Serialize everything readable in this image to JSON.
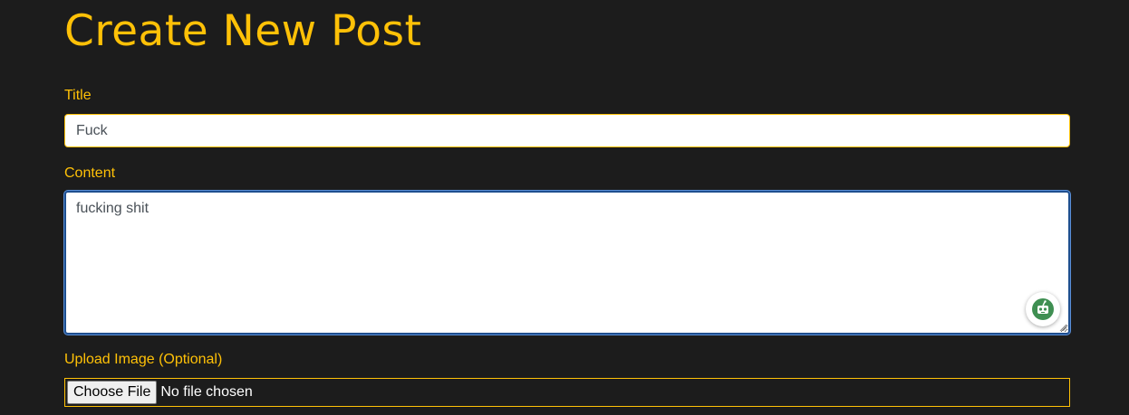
{
  "page": {
    "heading": "Create New Post"
  },
  "form": {
    "title_label": "Title",
    "title_value": "Fuck",
    "content_label": "Content",
    "content_value": "fucking shit",
    "upload_label": "Upload Image (Optional)",
    "file_button_label": "Choose File",
    "file_status": "No file chosen"
  },
  "icons": {
    "assistant": "robot-assistant-icon",
    "resize": "resize-grip-icon"
  },
  "colors": {
    "background": "#1c1c1c",
    "accent": "#ffc107",
    "focus_border": "#1f4f8f",
    "assistant_green": "#3f8f52"
  }
}
